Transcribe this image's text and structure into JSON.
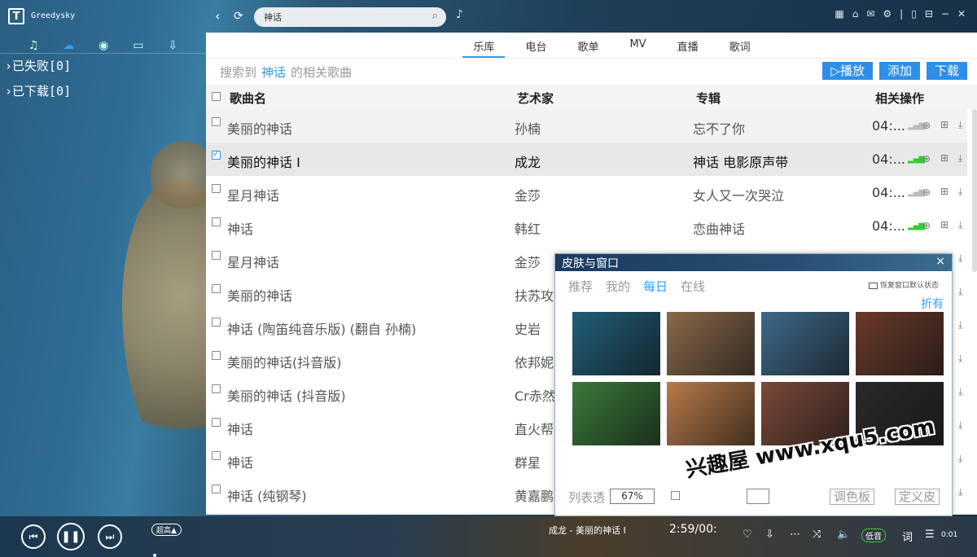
{
  "app": {
    "name": "Greedysky",
    "logo_letter": "T"
  },
  "search": {
    "value": "神话"
  },
  "left": {
    "tree": [
      {
        "label": "›已失败[0]"
      },
      {
        "label": "›已下载[0]"
      }
    ]
  },
  "tabs": [
    {
      "label": "乐库",
      "active": true
    },
    {
      "label": "电台"
    },
    {
      "label": "歌单"
    },
    {
      "label": "MV"
    },
    {
      "label": "直播"
    },
    {
      "label": "歌词"
    }
  ],
  "hint": {
    "prefix": "搜索到",
    "keyword": "神话",
    "suffix": "的相关歌曲"
  },
  "actions": {
    "play": "▷播放",
    "add": "添加",
    "download": "下载"
  },
  "table": {
    "headers": {
      "name": "歌曲名",
      "artist": "艺术家",
      "album": "专辑",
      "ops": "相关操作"
    },
    "rows": [
      {
        "name": "美丽的神话",
        "artist": "孙楠",
        "album": "忘不了你",
        "dur": "04:...",
        "checked": false
      },
      {
        "name": "美丽的神话 I",
        "artist": "成龙",
        "album": "神话 电影原声带",
        "dur": "04:...",
        "checked": true
      },
      {
        "name": "星月神话",
        "artist": "金莎",
        "album": "女人又一次哭泣",
        "dur": "04:...",
        "checked": false
      },
      {
        "name": "神话",
        "artist": "韩红",
        "album": "恋曲神话",
        "dur": "04:...",
        "checked": false
      },
      {
        "name": "星月神话",
        "artist": "金莎",
        "album": "",
        "dur": "",
        "checked": false
      },
      {
        "name": "美丽的神话",
        "artist": "扶苏攻",
        "album": "",
        "dur": "",
        "checked": false
      },
      {
        "name": "神话 (陶笛纯音乐版) (翻自 孙楠)",
        "artist": "史岩",
        "album": "",
        "dur": "",
        "checked": false
      },
      {
        "name": "美丽的神话(抖音版)",
        "artist": "依邦妮",
        "album": "",
        "dur": "",
        "checked": false
      },
      {
        "name": "美丽的神话 (抖音版)",
        "artist": "Cr赤然",
        "album": "",
        "dur": "",
        "checked": false
      },
      {
        "name": "神话",
        "artist": "直火帮",
        "album": "",
        "dur": "",
        "checked": false
      },
      {
        "name": "神话",
        "artist": "群星",
        "album": "",
        "dur": "",
        "checked": false
      },
      {
        "name": "神话 (纯钢琴)",
        "artist": "黄嘉鹏",
        "album": "",
        "dur": "",
        "checked": false
      }
    ]
  },
  "skin": {
    "title": "皮肤与窗口",
    "close": "×",
    "tabs": [
      "推荐",
      "我的",
      "每日",
      "在线"
    ],
    "active_tab": "每日",
    "restore": "恢复窗口默认状态",
    "fold": "折有",
    "opacity_label": "列表透",
    "opacity_value": "67%",
    "palette": "调色板",
    "custom": "定义皮",
    "thumb_colors": [
      "#1f5f78",
      "#8a6a4a",
      "#3d6a8a",
      "#6a3a2a",
      "#3a7a3a",
      "#b87a4a",
      "#7a4a3a",
      "#2a2a2a"
    ]
  },
  "watermark": "兴趣屋 www.xqu5.com",
  "player": {
    "quality": "超高▲",
    "now_playing": "成龙 - 美丽的神话 I",
    "time": "2:59/00:",
    "low_quality": "低音",
    "lyric": "词",
    "counter": "0:01"
  }
}
